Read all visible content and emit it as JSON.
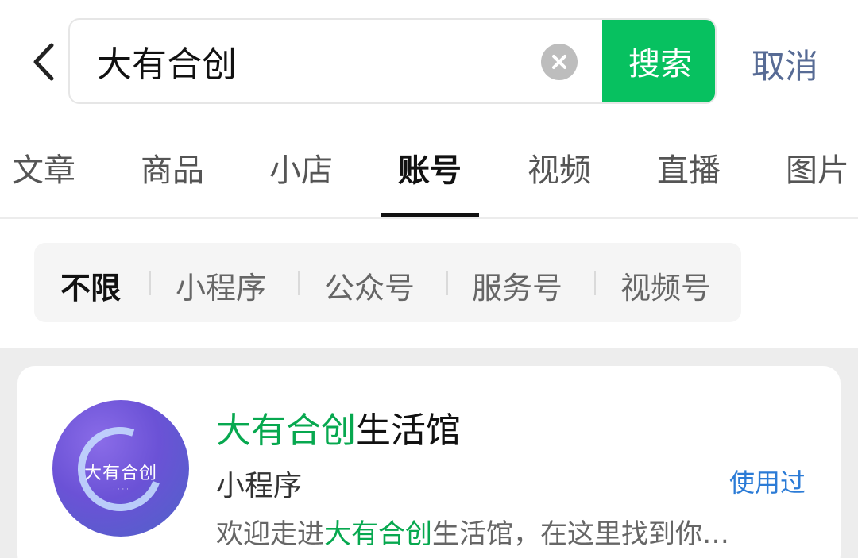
{
  "search": {
    "query": "大有合创",
    "button_label": "搜索",
    "cancel_label": "取消"
  },
  "tabs": [
    {
      "label": "文章"
    },
    {
      "label": "商品"
    },
    {
      "label": "小店"
    },
    {
      "label": "账号",
      "active": true
    },
    {
      "label": "视频"
    },
    {
      "label": "直播"
    },
    {
      "label": "图片"
    }
  ],
  "filters": [
    {
      "label": "不限",
      "active": true
    },
    {
      "label": "小程序"
    },
    {
      "label": "公众号"
    },
    {
      "label": "服务号"
    },
    {
      "label": "视频号"
    }
  ],
  "results": [
    {
      "avatar_text": "大有合创",
      "title_highlight": "大有合创",
      "title_rest": "生活馆",
      "type": "小程序",
      "used_label": "使用过",
      "desc_prefix": "欢迎走进",
      "desc_highlight": "大有合创",
      "desc_rest": "生活馆，在这里找到你…"
    }
  ],
  "colors": {
    "accent_green": "#07c160",
    "highlight_green": "#07a84f",
    "link_blue": "#576b95",
    "used_blue": "#2b7bd6"
  }
}
